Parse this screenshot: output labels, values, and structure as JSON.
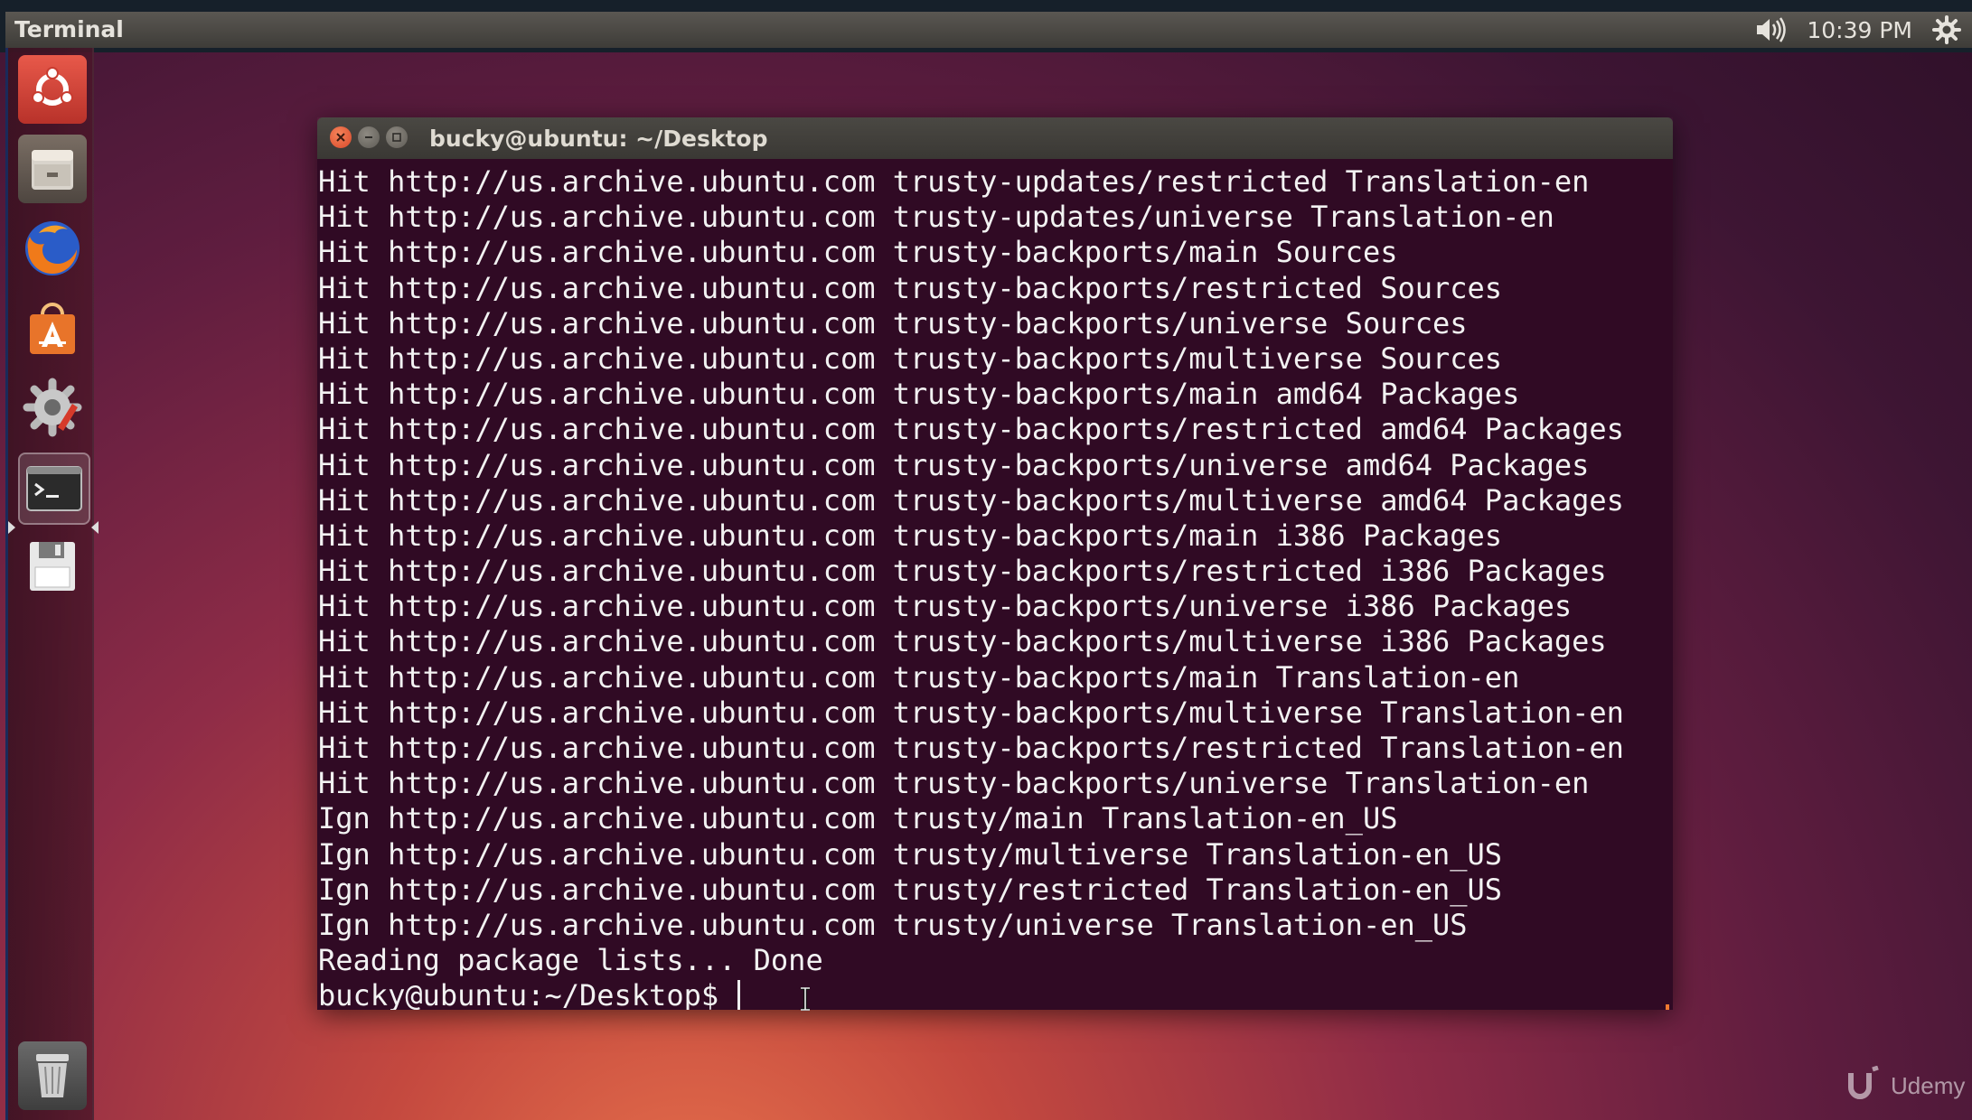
{
  "topbar": {
    "app_title": "Terminal",
    "time": "10:39 PM",
    "icons": [
      "volume-icon",
      "gear-icon"
    ]
  },
  "launcher": {
    "items": [
      {
        "name": "dash-home",
        "icon": "ubuntu-logo-icon"
      },
      {
        "name": "files",
        "icon": "file-cabinet-icon"
      },
      {
        "name": "firefox",
        "icon": "firefox-icon"
      },
      {
        "name": "software-center",
        "icon": "shopping-bag-icon"
      },
      {
        "name": "system-settings",
        "icon": "settings-wrench-icon"
      },
      {
        "name": "terminal",
        "icon": "terminal-icon",
        "active": true
      },
      {
        "name": "save-disk",
        "icon": "floppy-disk-icon"
      },
      {
        "name": "trash",
        "icon": "trash-icon"
      }
    ]
  },
  "window": {
    "title": "bucky@ubuntu: ~/Desktop",
    "controls": [
      "close",
      "minimize",
      "maximize"
    ]
  },
  "terminal": {
    "lines": [
      "Hit http://us.archive.ubuntu.com trusty-updates/restricted Translation-en",
      "Hit http://us.archive.ubuntu.com trusty-updates/universe Translation-en",
      "Hit http://us.archive.ubuntu.com trusty-backports/main Sources",
      "Hit http://us.archive.ubuntu.com trusty-backports/restricted Sources",
      "Hit http://us.archive.ubuntu.com trusty-backports/universe Sources",
      "Hit http://us.archive.ubuntu.com trusty-backports/multiverse Sources",
      "Hit http://us.archive.ubuntu.com trusty-backports/main amd64 Packages",
      "Hit http://us.archive.ubuntu.com trusty-backports/restricted amd64 Packages",
      "Hit http://us.archive.ubuntu.com trusty-backports/universe amd64 Packages",
      "Hit http://us.archive.ubuntu.com trusty-backports/multiverse amd64 Packages",
      "Hit http://us.archive.ubuntu.com trusty-backports/main i386 Packages",
      "Hit http://us.archive.ubuntu.com trusty-backports/restricted i386 Packages",
      "Hit http://us.archive.ubuntu.com trusty-backports/universe i386 Packages",
      "Hit http://us.archive.ubuntu.com trusty-backports/multiverse i386 Packages",
      "Hit http://us.archive.ubuntu.com trusty-backports/main Translation-en",
      "Hit http://us.archive.ubuntu.com trusty-backports/multiverse Translation-en",
      "Hit http://us.archive.ubuntu.com trusty-backports/restricted Translation-en",
      "Hit http://us.archive.ubuntu.com trusty-backports/universe Translation-en",
      "Ign http://us.archive.ubuntu.com trusty/main Translation-en_US",
      "Ign http://us.archive.ubuntu.com trusty/multiverse Translation-en_US",
      "Ign http://us.archive.ubuntu.com trusty/restricted Translation-en_US",
      "Ign http://us.archive.ubuntu.com trusty/universe Translation-en_US",
      "Reading package lists... Done"
    ],
    "prompt": "bucky@ubuntu:~/Desktop$ "
  },
  "watermark": {
    "text": "Udemy"
  },
  "colors": {
    "terminal_bg": "#300a24",
    "close_button": "#e0522a",
    "accent_orange": "#f07a30"
  }
}
